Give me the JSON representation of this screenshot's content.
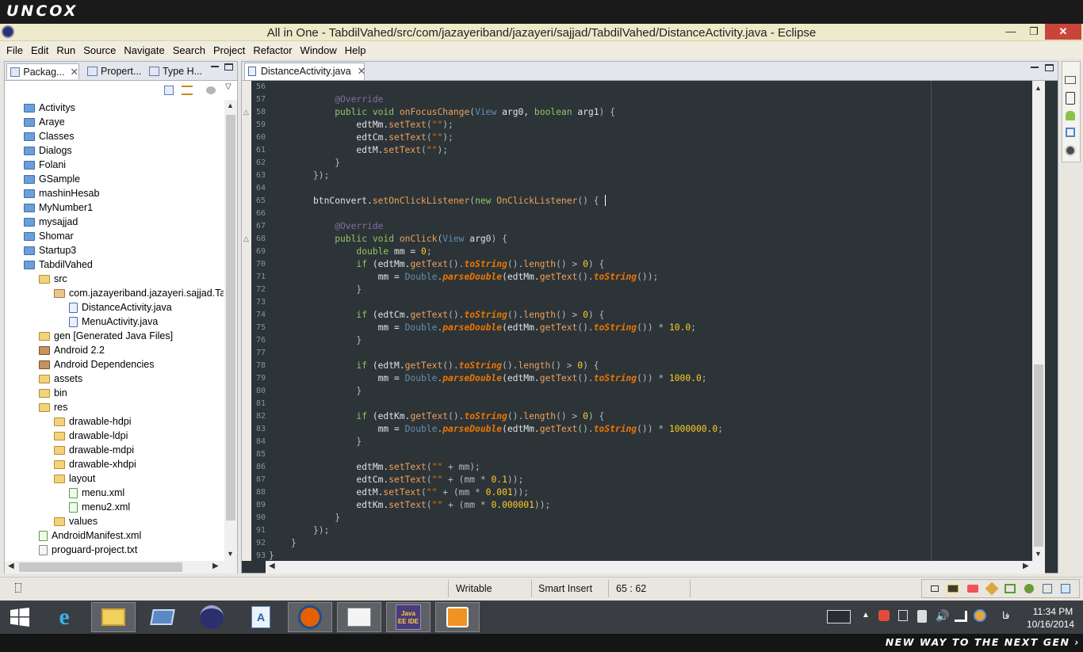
{
  "brand": "UNCOX",
  "window": {
    "title": "All in One - TabdilVahed/src/com/jazayeriband/jazayeri/sajjad/TabdilVahed/DistanceActivity.java - Eclipse",
    "minimize": "—",
    "maximize": "❐",
    "close": "✕"
  },
  "menu": [
    "File",
    "Edit",
    "Run",
    "Source",
    "Navigate",
    "Search",
    "Project",
    "Refactor",
    "Window",
    "Help"
  ],
  "package_explorer": {
    "tabs": [
      "Packag...",
      "Propert...",
      "Type H..."
    ],
    "tree": [
      {
        "label": "Activitys",
        "icon": "project-icon",
        "indent": 0
      },
      {
        "label": "Araye",
        "icon": "project-icon",
        "indent": 0
      },
      {
        "label": "Classes",
        "icon": "project-icon",
        "indent": 0
      },
      {
        "label": "Dialogs",
        "icon": "project-icon",
        "indent": 0
      },
      {
        "label": "Folani",
        "icon": "project-icon",
        "indent": 0
      },
      {
        "label": "GSample",
        "icon": "project-icon",
        "indent": 0
      },
      {
        "label": "mashinHesab",
        "icon": "project-icon",
        "indent": 0
      },
      {
        "label": "MyNumber1",
        "icon": "project-icon",
        "indent": 0
      },
      {
        "label": "mysajjad",
        "icon": "project-icon",
        "indent": 0
      },
      {
        "label": "Shomar",
        "icon": "project-icon",
        "indent": 0
      },
      {
        "label": "Startup3",
        "icon": "project-icon",
        "indent": 0
      },
      {
        "label": "TabdilVahed",
        "icon": "project-icon",
        "indent": 0
      },
      {
        "label": "src",
        "icon": "source-folder-icon",
        "indent": 1
      },
      {
        "label": "com.jazayeriband.jazayeri.sajjad.Tabd",
        "icon": "package-icon",
        "indent": 2
      },
      {
        "label": "DistanceActivity.java",
        "icon": "java-file-icon",
        "indent": 3
      },
      {
        "label": "MenuActivity.java",
        "icon": "java-file-icon",
        "indent": 3
      },
      {
        "label": "gen [Generated Java Files]",
        "icon": "source-folder-icon",
        "indent": 1
      },
      {
        "label": "Android 2.2",
        "icon": "library-icon",
        "indent": 1
      },
      {
        "label": "Android Dependencies",
        "icon": "library-icon",
        "indent": 1
      },
      {
        "label": "assets",
        "icon": "folder-icon",
        "indent": 1
      },
      {
        "label": "bin",
        "icon": "folder-icon",
        "indent": 1
      },
      {
        "label": "res",
        "icon": "folder-icon",
        "indent": 1
      },
      {
        "label": "drawable-hdpi",
        "icon": "folder-icon",
        "indent": 2
      },
      {
        "label": "drawable-ldpi",
        "icon": "folder-icon",
        "indent": 2
      },
      {
        "label": "drawable-mdpi",
        "icon": "folder-icon",
        "indent": 2
      },
      {
        "label": "drawable-xhdpi",
        "icon": "folder-icon",
        "indent": 2
      },
      {
        "label": "layout",
        "icon": "folder-icon",
        "indent": 2
      },
      {
        "label": "menu.xml",
        "icon": "xml-file-icon",
        "indent": 3
      },
      {
        "label": "menu2.xml",
        "icon": "xml-file-icon",
        "indent": 3
      },
      {
        "label": "values",
        "icon": "folder-icon",
        "indent": 2
      },
      {
        "label": "AndroidManifest.xml",
        "icon": "xml-file-icon",
        "indent": 1
      },
      {
        "label": "proguard-project.txt",
        "icon": "text-file-icon",
        "indent": 1
      }
    ]
  },
  "editor": {
    "tab_label": "DistanceActivity.java",
    "first_line": 56,
    "lines": [
      [],
      [
        [
          "    @Override",
          "an"
        ]
      ],
      [
        [
          "    ",
          "pr"
        ],
        [
          "public void ",
          "kw"
        ],
        [
          "onFocusChange",
          "me"
        ],
        [
          "(",
          "pa"
        ],
        [
          "View ",
          "ty"
        ],
        [
          "arg0, ",
          "pr"
        ],
        [
          "boolean ",
          "kw"
        ],
        [
          "arg1",
          "pr"
        ],
        [
          ") {",
          "pa"
        ]
      ],
      [
        [
          "        edtMm.",
          "pr"
        ],
        [
          "setText",
          "me"
        ],
        [
          "(",
          "pa"
        ],
        [
          "\"\"",
          "str"
        ],
        [
          ");",
          "pa"
        ]
      ],
      [
        [
          "        edtCm.",
          "pr"
        ],
        [
          "setText",
          "me"
        ],
        [
          "(",
          "pa"
        ],
        [
          "\"\"",
          "str"
        ],
        [
          ");",
          "pa"
        ]
      ],
      [
        [
          "        edtM.",
          "pr"
        ],
        [
          "setText",
          "me"
        ],
        [
          "(",
          "pa"
        ],
        [
          "\"\"",
          "str"
        ],
        [
          ");",
          "pa"
        ]
      ],
      [
        [
          "    }",
          "pa"
        ]
      ],
      [
        [
          "});",
          "pa"
        ]
      ],
      [],
      [
        [
          "btnConvert.",
          "pr"
        ],
        [
          "setOnClickListener",
          "me"
        ],
        [
          "(",
          "pa"
        ],
        [
          "new ",
          "kw"
        ],
        [
          "OnClickListener",
          "me"
        ],
        [
          "() {",
          "pa"
        ]
      ],
      [],
      [
        [
          "    @Override",
          "an"
        ]
      ],
      [
        [
          "    ",
          "pr"
        ],
        [
          "public void ",
          "kw"
        ],
        [
          "onClick",
          "me"
        ],
        [
          "(",
          "pa"
        ],
        [
          "View ",
          "ty"
        ],
        [
          "arg0",
          "pr"
        ],
        [
          ") {",
          "pa"
        ]
      ],
      [
        [
          "        ",
          "pr"
        ],
        [
          "double ",
          "kw"
        ],
        [
          "mm = ",
          "pr"
        ],
        [
          "0",
          "nu"
        ],
        [
          ";",
          "pa"
        ]
      ],
      [
        [
          "        ",
          "pr"
        ],
        [
          "if ",
          "kw"
        ],
        [
          "(edtMm.",
          "pr"
        ],
        [
          "getText",
          "me"
        ],
        [
          "().",
          "pa"
        ],
        [
          "toString",
          "st"
        ],
        [
          "().",
          "pa"
        ],
        [
          "length",
          "me"
        ],
        [
          "() > ",
          "pa"
        ],
        [
          "0",
          "nu"
        ],
        [
          ") {",
          "pa"
        ]
      ],
      [
        [
          "            mm = ",
          "pr"
        ],
        [
          "Double",
          "ty"
        ],
        [
          ".",
          "pa"
        ],
        [
          "parseDouble",
          "st"
        ],
        [
          "(edtMm.",
          "pr"
        ],
        [
          "getText",
          "me"
        ],
        [
          "().",
          "pa"
        ],
        [
          "toString",
          "st"
        ],
        [
          "());",
          "pa"
        ]
      ],
      [
        [
          "        }",
          "pa"
        ]
      ],
      [],
      [
        [
          "        ",
          "pr"
        ],
        [
          "if ",
          "kw"
        ],
        [
          "(edtCm.",
          "pr"
        ],
        [
          "getText",
          "me"
        ],
        [
          "().",
          "pa"
        ],
        [
          "toString",
          "st"
        ],
        [
          "().",
          "pa"
        ],
        [
          "length",
          "me"
        ],
        [
          "() > ",
          "pa"
        ],
        [
          "0",
          "nu"
        ],
        [
          ") {",
          "pa"
        ]
      ],
      [
        [
          "            mm = ",
          "pr"
        ],
        [
          "Double",
          "ty"
        ],
        [
          ".",
          "pa"
        ],
        [
          "parseDouble",
          "st"
        ],
        [
          "(edtMm.",
          "pr"
        ],
        [
          "getText",
          "me"
        ],
        [
          "().",
          "pa"
        ],
        [
          "toString",
          "st"
        ],
        [
          "()) * ",
          "pa"
        ],
        [
          "10.0",
          "nu"
        ],
        [
          ";",
          "pa"
        ]
      ],
      [
        [
          "        }",
          "pa"
        ]
      ],
      [],
      [
        [
          "        ",
          "pr"
        ],
        [
          "if ",
          "kw"
        ],
        [
          "(edtM.",
          "pr"
        ],
        [
          "getText",
          "me"
        ],
        [
          "().",
          "pa"
        ],
        [
          "toString",
          "st"
        ],
        [
          "().",
          "pa"
        ],
        [
          "length",
          "me"
        ],
        [
          "() > ",
          "pa"
        ],
        [
          "0",
          "nu"
        ],
        [
          ") {",
          "pa"
        ]
      ],
      [
        [
          "            mm = ",
          "pr"
        ],
        [
          "Double",
          "ty"
        ],
        [
          ".",
          "pa"
        ],
        [
          "parseDouble",
          "st"
        ],
        [
          "(edtMm.",
          "pr"
        ],
        [
          "getText",
          "me"
        ],
        [
          "().",
          "pa"
        ],
        [
          "toString",
          "st"
        ],
        [
          "()) * ",
          "pa"
        ],
        [
          "1000.0",
          "nu"
        ],
        [
          ";",
          "pa"
        ]
      ],
      [
        [
          "        }",
          "pa"
        ]
      ],
      [],
      [
        [
          "        ",
          "pr"
        ],
        [
          "if ",
          "kw"
        ],
        [
          "(edtKm.",
          "pr"
        ],
        [
          "getText",
          "me"
        ],
        [
          "().",
          "pa"
        ],
        [
          "toString",
          "st"
        ],
        [
          "().",
          "pa"
        ],
        [
          "length",
          "me"
        ],
        [
          "() > ",
          "pa"
        ],
        [
          "0",
          "nu"
        ],
        [
          ") {",
          "pa"
        ]
      ],
      [
        [
          "            mm = ",
          "pr"
        ],
        [
          "Double",
          "ty"
        ],
        [
          ".",
          "pa"
        ],
        [
          "parseDouble",
          "st"
        ],
        [
          "(edtMm.",
          "pr"
        ],
        [
          "getText",
          "me"
        ],
        [
          "().",
          "pa"
        ],
        [
          "toString",
          "st"
        ],
        [
          "()) * ",
          "pa"
        ],
        [
          "1000000.0",
          "nu"
        ],
        [
          ";",
          "pa"
        ]
      ],
      [
        [
          "        }",
          "pa"
        ]
      ],
      [],
      [
        [
          "        edtMm.",
          "pr"
        ],
        [
          "setText",
          "me"
        ],
        [
          "(",
          "pa"
        ],
        [
          "\"\" ",
          "str"
        ],
        [
          "+ mm);",
          "pa"
        ]
      ],
      [
        [
          "        edtCm.",
          "pr"
        ],
        [
          "setText",
          "me"
        ],
        [
          "(",
          "pa"
        ],
        [
          "\"\" ",
          "str"
        ],
        [
          "+ (mm * ",
          "pa"
        ],
        [
          "0.1",
          "nu"
        ],
        [
          "));",
          "pa"
        ]
      ],
      [
        [
          "        edtM.",
          "pr"
        ],
        [
          "setText",
          "me"
        ],
        [
          "(",
          "pa"
        ],
        [
          "\"\" ",
          "str"
        ],
        [
          "+ (mm * ",
          "pa"
        ],
        [
          "0.001",
          "nu"
        ],
        [
          "));",
          "pa"
        ]
      ],
      [
        [
          "        edtKm.",
          "pr"
        ],
        [
          "setText",
          "me"
        ],
        [
          "(",
          "pa"
        ],
        [
          "\"\" ",
          "str"
        ],
        [
          "+ (mm * ",
          "pa"
        ],
        [
          "0.000001",
          "nu"
        ],
        [
          "));",
          "pa"
        ]
      ],
      [
        [
          "    }",
          "pa"
        ]
      ],
      [
        [
          "});",
          "pa"
        ]
      ],
      [
        [
          "}",
          "pa"
        ]
      ],
      [
        [
          "}",
          "pa"
        ]
      ]
    ],
    "indents": [
      0,
      2,
      2,
      2,
      2,
      2,
      2,
      2,
      0,
      2,
      0,
      2,
      2,
      2,
      2,
      2,
      2,
      0,
      2,
      2,
      2,
      0,
      2,
      2,
      2,
      0,
      2,
      2,
      2,
      0,
      2,
      2,
      2,
      2,
      2,
      2,
      1,
      0
    ]
  },
  "status": {
    "writable": "Writable",
    "insert_mode": "Smart Insert",
    "position": "65 : 62"
  },
  "taskbar": {
    "apps": [
      "start-button",
      "internet-explorer-icon",
      "file-explorer-icon",
      "remote-desktop-icon",
      "eclipse-icon",
      "wordpad-icon",
      "firefox-icon",
      "text-editor-icon",
      "java-ee-ide-icon",
      "media-player-icon"
    ],
    "java_ee_label": "Java EE IDE",
    "lang": "فا",
    "time": "11:34 PM",
    "date": "10/16/2014"
  },
  "tagline": "NEW WAY TO THE NEXT GEN ›"
}
